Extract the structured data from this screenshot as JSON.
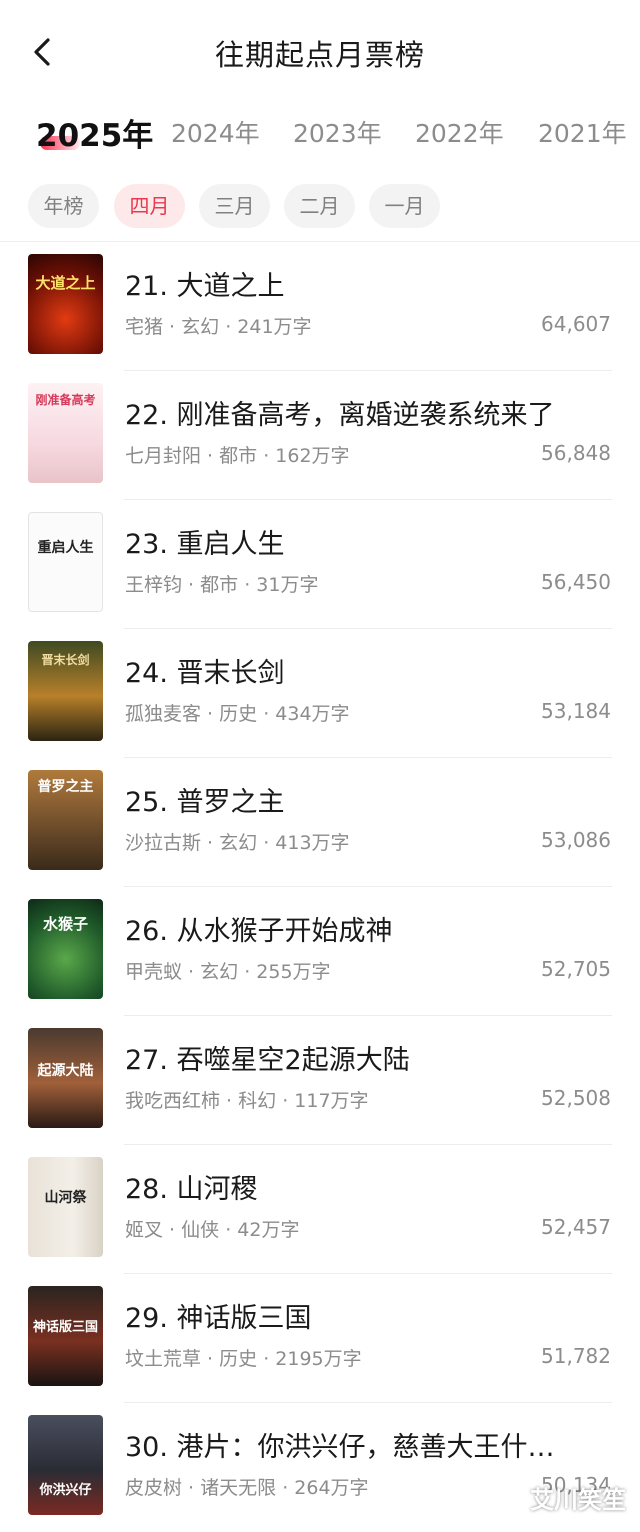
{
  "header": {
    "title": "往期起点月票榜"
  },
  "years": [
    "2025年",
    "2024年",
    "2023年",
    "2022年",
    "2021年"
  ],
  "months": [
    "年榜",
    "四月",
    "三月",
    "二月",
    "一月"
  ],
  "books": [
    {
      "title": "21. 大道之上",
      "author": "宅猪",
      "genre": "玄幻",
      "words": "241万字",
      "votes": "64,607",
      "cover_text": "大道之上"
    },
    {
      "title": "22. 刚准备高考，离婚逆袭系统来了",
      "author": "七月封阳",
      "genre": "都市",
      "words": "162万字",
      "votes": "56,848",
      "cover_text": "刚准备高考"
    },
    {
      "title": "23. 重启人生",
      "author": "王梓钧",
      "genre": "都市",
      "words": "31万字",
      "votes": "56,450",
      "cover_text": "重启人生"
    },
    {
      "title": "24. 晋末长剑",
      "author": "孤独麦客",
      "genre": "历史",
      "words": "434万字",
      "votes": "53,184",
      "cover_text": "晋末长剑"
    },
    {
      "title": "25. 普罗之主",
      "author": "沙拉古斯",
      "genre": "玄幻",
      "words": "413万字",
      "votes": "53,086",
      "cover_text": "普罗之主"
    },
    {
      "title": "26. 从水猴子开始成神",
      "author": "甲壳蚁",
      "genre": "玄幻",
      "words": "255万字",
      "votes": "52,705",
      "cover_text": "水猴子"
    },
    {
      "title": "27. 吞噬星空2起源大陆",
      "author": "我吃西红柿",
      "genre": "科幻",
      "words": "117万字",
      "votes": "52,508",
      "cover_text": "起源大陆"
    },
    {
      "title": "28. 山河稷",
      "author": "姬叉",
      "genre": "仙侠",
      "words": "42万字",
      "votes": "52,457",
      "cover_text": "山河祭"
    },
    {
      "title": "29. 神话版三国",
      "author": "坟土荒草",
      "genre": "历史",
      "words": "2195万字",
      "votes": "51,782",
      "cover_text": "神话版三国"
    },
    {
      "title": "30. 港片：你洪兴仔，慈善大王什…",
      "author": "皮皮树",
      "genre": "诸天无限",
      "words": "264万字",
      "votes": "50,134",
      "cover_text": "你洪兴仔"
    }
  ],
  "meta_separator": " · ",
  "watermark": "艾川笑笙",
  "colors": {
    "accent": "#e8394f",
    "chip_bg": "#f3f3f3",
    "text_gray": "#8c8c8c"
  }
}
